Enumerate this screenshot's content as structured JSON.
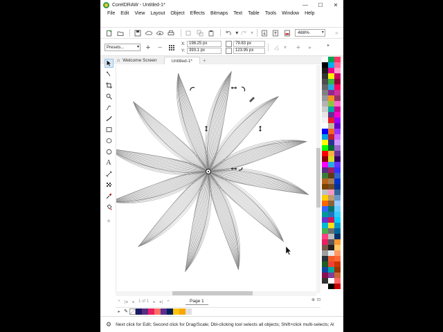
{
  "app": {
    "title": "CorelDRAW - Untitled-1*",
    "window_controls": {
      "minimize": "—",
      "maximize": "☐",
      "close": "✕"
    }
  },
  "menu": [
    "File",
    "Edit",
    "View",
    "Layout",
    "Object",
    "Effects",
    "Bitmaps",
    "Text",
    "Table",
    "Tools",
    "Window",
    "Help"
  ],
  "toolbar": {
    "zoom": "488%"
  },
  "propbar": {
    "presets": "Presets...",
    "x_label": "X:",
    "x_value": "198.25 px",
    "y_label": "Y:",
    "y_value": "393.1 px",
    "w_value": "79.83 px",
    "h_value": "123.95 px"
  },
  "tabs": {
    "welcome": "Welcome Screen",
    "doc": "Untitled-1*",
    "add": "+"
  },
  "pagenav": {
    "page_of": "1 of 1",
    "page_tab": "Page 1"
  },
  "status": {
    "text": "Next click for Edit; Second click for Drag/Scale; Dbl-clicking tool selects all objects; Shift+click multi-selects; Al"
  },
  "colors": {
    "palette_col1": [
      "#ffffff",
      "#000000",
      "#1a1a1a",
      "#333333",
      "#4d4d4d",
      "#666666",
      "#808080",
      "#999999",
      "#b3b3b3",
      "#cccccc",
      "#e6e6e6",
      "#f2f2f2",
      "#ffffff",
      "#0000ff",
      "#00a0e9",
      "#ffff00",
      "#00ff00",
      "#ff0000",
      "#8b0000",
      "#ff00ff",
      "#5a2d82",
      "#3a7d3a",
      "#b5651d",
      "#7b3f00",
      "#c0c0c0",
      "#ffcc00",
      "#ff6600",
      "#3366ff",
      "#009999",
      "#6633cc",
      "#00bcd4",
      "#4caf50",
      "#ff4081",
      "#e91e63",
      "#795548",
      "#9e9e9e",
      "#263238",
      "#1b5e20",
      "#0d47a1",
      "#880e4f",
      "#333333",
      "#ffffff"
    ],
    "palette_col2": [
      "#00a651",
      "#00aeef",
      "#ec008c",
      "#fff200",
      "#39b54a",
      "#29abe2",
      "#92278f",
      "#f7941d",
      "#8dc63f",
      "#00a99d",
      "#662d91",
      "#ed1c24",
      "#c2b59b",
      "#f26522",
      "#be1e2d",
      "#2e3192",
      "#006838",
      "#fbb040",
      "#d7df23",
      "#27aae1",
      "#9e1f63",
      "#603913",
      "#a97c50",
      "#754c24",
      "#f49ac2",
      "#c49a6c",
      "#8c6239",
      "#00746b",
      "#1c75bc",
      "#d3145a",
      "#ffde17",
      "#6d6e71",
      "#bcbec0",
      "#58595b",
      "#231f20",
      "#e6e7e8",
      "#f15a29",
      "#ef4136",
      "#00a79d",
      "#7f3f98",
      "#ffffff",
      "#000000"
    ],
    "palette_col3": [
      "#ff3366",
      "#ff6699",
      "#ff99cc",
      "#cc0066",
      "#990033",
      "#ff0066",
      "#cc3399",
      "#993366",
      "#ff66cc",
      "#cc0099",
      "#ff00cc",
      "#9900ff",
      "#6600cc",
      "#9933ff",
      "#cc66ff",
      "#cc99ff",
      "#9966cc",
      "#663399",
      "#330066",
      "#6633ff",
      "#3333ff",
      "#3366cc",
      "#0033cc",
      "#003399",
      "#336699",
      "#6699cc",
      "#99ccff",
      "#66ccff",
      "#33ccff",
      "#00ccff",
      "#0099cc",
      "#006699",
      "#003366",
      "#ff9933",
      "#ffcc66",
      "#ff9966",
      "#ff6633",
      "#cc3300",
      "#993300",
      "#cc6633",
      "#ff6666",
      "#cc0000"
    ],
    "doc_palette": [
      "#1a1a66",
      "#5a2d82",
      "#e91e63",
      "#ff6f61",
      "#5c2e91",
      "#00205b",
      "#ffc20e",
      "#f7a800",
      "#e0e0e0"
    ]
  }
}
